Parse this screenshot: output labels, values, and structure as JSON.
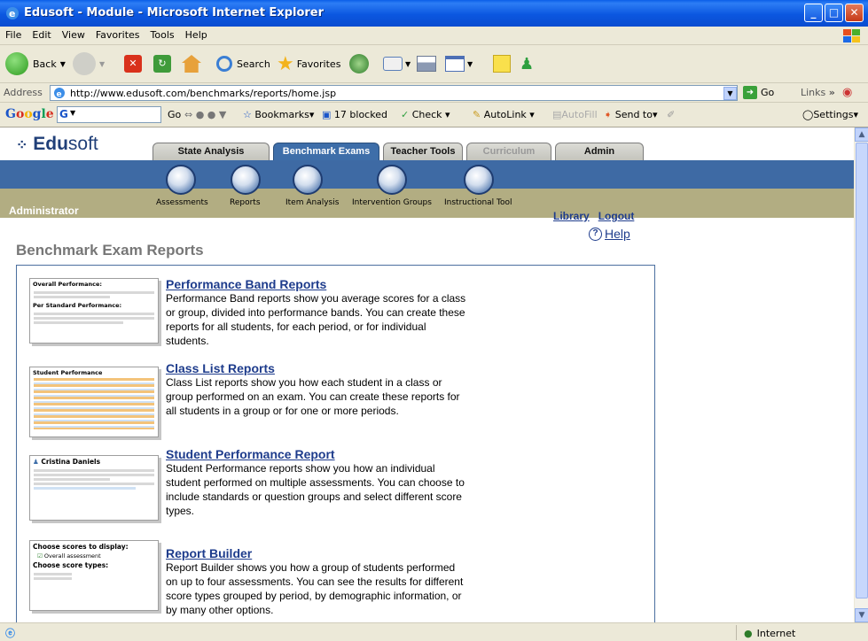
{
  "window": {
    "title": "Edusoft - Module - Microsoft Internet Explorer",
    "buttons": [
      "_",
      "□",
      "✕"
    ]
  },
  "menu": [
    "File",
    "Edit",
    "View",
    "Favorites",
    "Tools",
    "Help"
  ],
  "toolbar": {
    "back": "Back",
    "search": "Search",
    "favorites": "Favorites"
  },
  "address": {
    "label": "Address",
    "url": "http://www.edusoft.com/benchmarks/reports/home.jsp",
    "go": "Go",
    "links": "Links"
  },
  "googlebar": {
    "logo": "Google",
    "go": "Go",
    "bookmarks": "Bookmarks",
    "blocked": "17 blocked",
    "check": "Check",
    "autolink": "AutoLink",
    "autofill": "AutoFill",
    "sendto": "Send to",
    "settings": "Settings"
  },
  "site": {
    "logo_prefix": "Edu",
    "logo_suffix": "soft",
    "tabs": [
      "State Analysis",
      "Benchmark Exams",
      "Teacher Tools",
      "Curriculum",
      "Admin"
    ],
    "nav": [
      "Assessments",
      "Reports",
      "Item Analysis",
      "Intervention Groups",
      "Instructional Tool"
    ],
    "role": "Administrator",
    "library": "Library",
    "logout": "Logout",
    "help": "Help",
    "help_icon_glyph": "?",
    "page_title": "Benchmark Exam Reports"
  },
  "reports": [
    {
      "title": "Performance Band Reports",
      "description": "Performance Band reports show you average scores for a class or group, divided into performance bands. You can create these reports for all students, for each period, or for individual students.",
      "thumb_heading": "Overall Performance:",
      "thumb_heading2": "Per Standard Performance:"
    },
    {
      "title": "Class List Reports",
      "description": "Class List reports show you how each student in a class or group performed on an exam. You can create these reports for all students in a group or for one or more periods.",
      "thumb_heading": "Student Performance"
    },
    {
      "title": "Student Performance Report",
      "description": "Student Performance reports show you how an individual student performed on multiple assessments. You can choose to include standards or question groups and select different score types.",
      "thumb_heading": "Cristina Daniels"
    },
    {
      "title": "Report Builder",
      "description": "Report Builder shows you how a group of students performed on up to four assessments. You can see the results for different score types grouped by period, by demographic information, or by many other options.",
      "thumb_heading": "Choose scores to display:",
      "thumb_option1": "Overall assessment",
      "thumb_heading2": "Choose score types:"
    }
  ],
  "status": {
    "zone": "Internet"
  }
}
